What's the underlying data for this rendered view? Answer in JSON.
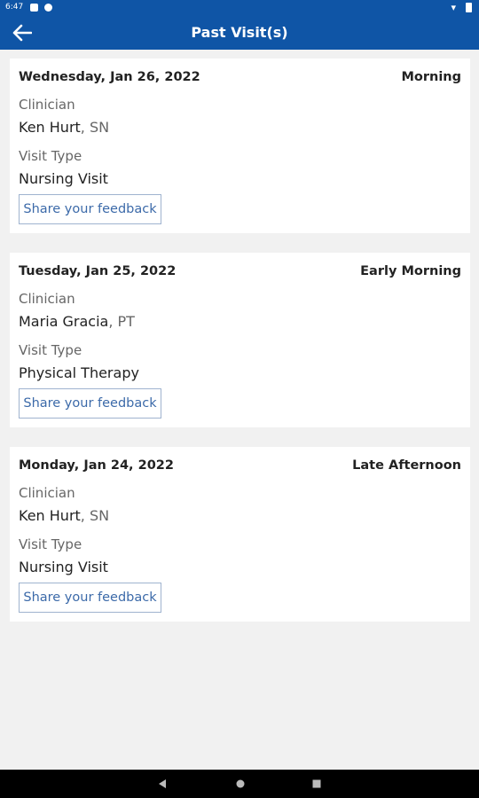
{
  "status_bar": {
    "time": "6:47",
    "notification_icons": [
      "app-notification-icon",
      "google-icon"
    ],
    "system_icons": [
      "wifi-icon",
      "battery-icon"
    ]
  },
  "header": {
    "back_icon": "arrow-left-icon",
    "title": "Past Visit(s)"
  },
  "colors": {
    "header_bg": "#0f55a6",
    "page_bg": "#f1f1f1",
    "card_bg": "#ffffff",
    "link": "#3c6aa9"
  },
  "visits": [
    {
      "date": "Wednesday, Jan 26, 2022",
      "period": "Morning",
      "clinician_label": "Clinician",
      "clinician_name": "Ken Hurt",
      "clinician_role": ", SN",
      "visit_type_label": "Visit Type",
      "visit_type": "Nursing Visit",
      "feedback_label": "Share your feedback"
    },
    {
      "date": "Tuesday, Jan 25, 2022",
      "period": "Early Morning",
      "clinician_label": "Clinician",
      "clinician_name": "Maria Gracia",
      "clinician_role": ", PT",
      "visit_type_label": "Visit Type",
      "visit_type": "Physical Therapy",
      "feedback_label": "Share your feedback"
    },
    {
      "date": "Monday, Jan 24, 2022",
      "period": "Late Afternoon",
      "clinician_label": "Clinician",
      "clinician_name": "Ken Hurt",
      "clinician_role": ", SN",
      "visit_type_label": "Visit Type",
      "visit_type": "Nursing Visit",
      "feedback_label": "Share your feedback"
    }
  ],
  "nav_bar": {
    "icons": [
      "back-triangle-icon",
      "home-circle-icon",
      "recents-square-icon"
    ]
  }
}
